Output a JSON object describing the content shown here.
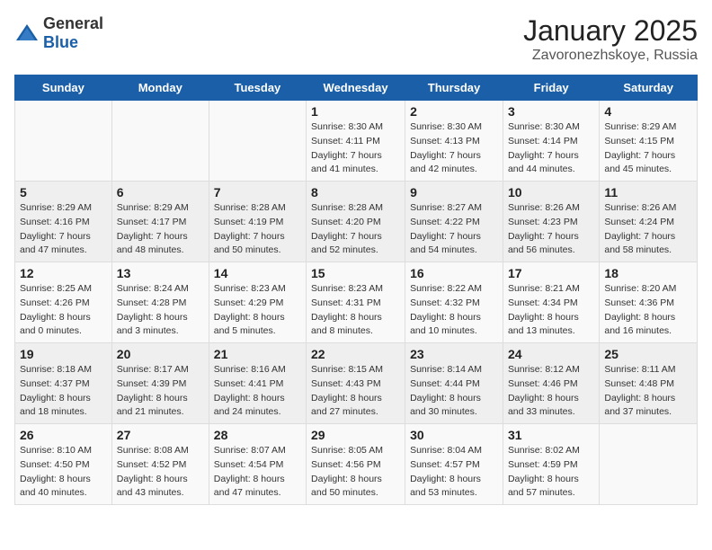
{
  "header": {
    "logo_general": "General",
    "logo_blue": "Blue",
    "month_title": "January 2025",
    "location": "Zavoronezhskoye, Russia"
  },
  "weekdays": [
    "Sunday",
    "Monday",
    "Tuesday",
    "Wednesday",
    "Thursday",
    "Friday",
    "Saturday"
  ],
  "weeks": [
    [
      {
        "day": "",
        "info": ""
      },
      {
        "day": "",
        "info": ""
      },
      {
        "day": "",
        "info": ""
      },
      {
        "day": "1",
        "info": "Sunrise: 8:30 AM\nSunset: 4:11 PM\nDaylight: 7 hours\nand 41 minutes."
      },
      {
        "day": "2",
        "info": "Sunrise: 8:30 AM\nSunset: 4:13 PM\nDaylight: 7 hours\nand 42 minutes."
      },
      {
        "day": "3",
        "info": "Sunrise: 8:30 AM\nSunset: 4:14 PM\nDaylight: 7 hours\nand 44 minutes."
      },
      {
        "day": "4",
        "info": "Sunrise: 8:29 AM\nSunset: 4:15 PM\nDaylight: 7 hours\nand 45 minutes."
      }
    ],
    [
      {
        "day": "5",
        "info": "Sunrise: 8:29 AM\nSunset: 4:16 PM\nDaylight: 7 hours\nand 47 minutes."
      },
      {
        "day": "6",
        "info": "Sunrise: 8:29 AM\nSunset: 4:17 PM\nDaylight: 7 hours\nand 48 minutes."
      },
      {
        "day": "7",
        "info": "Sunrise: 8:28 AM\nSunset: 4:19 PM\nDaylight: 7 hours\nand 50 minutes."
      },
      {
        "day": "8",
        "info": "Sunrise: 8:28 AM\nSunset: 4:20 PM\nDaylight: 7 hours\nand 52 minutes."
      },
      {
        "day": "9",
        "info": "Sunrise: 8:27 AM\nSunset: 4:22 PM\nDaylight: 7 hours\nand 54 minutes."
      },
      {
        "day": "10",
        "info": "Sunrise: 8:26 AM\nSunset: 4:23 PM\nDaylight: 7 hours\nand 56 minutes."
      },
      {
        "day": "11",
        "info": "Sunrise: 8:26 AM\nSunset: 4:24 PM\nDaylight: 7 hours\nand 58 minutes."
      }
    ],
    [
      {
        "day": "12",
        "info": "Sunrise: 8:25 AM\nSunset: 4:26 PM\nDaylight: 8 hours\nand 0 minutes."
      },
      {
        "day": "13",
        "info": "Sunrise: 8:24 AM\nSunset: 4:28 PM\nDaylight: 8 hours\nand 3 minutes."
      },
      {
        "day": "14",
        "info": "Sunrise: 8:23 AM\nSunset: 4:29 PM\nDaylight: 8 hours\nand 5 minutes."
      },
      {
        "day": "15",
        "info": "Sunrise: 8:23 AM\nSunset: 4:31 PM\nDaylight: 8 hours\nand 8 minutes."
      },
      {
        "day": "16",
        "info": "Sunrise: 8:22 AM\nSunset: 4:32 PM\nDaylight: 8 hours\nand 10 minutes."
      },
      {
        "day": "17",
        "info": "Sunrise: 8:21 AM\nSunset: 4:34 PM\nDaylight: 8 hours\nand 13 minutes."
      },
      {
        "day": "18",
        "info": "Sunrise: 8:20 AM\nSunset: 4:36 PM\nDaylight: 8 hours\nand 16 minutes."
      }
    ],
    [
      {
        "day": "19",
        "info": "Sunrise: 8:18 AM\nSunset: 4:37 PM\nDaylight: 8 hours\nand 18 minutes."
      },
      {
        "day": "20",
        "info": "Sunrise: 8:17 AM\nSunset: 4:39 PM\nDaylight: 8 hours\nand 21 minutes."
      },
      {
        "day": "21",
        "info": "Sunrise: 8:16 AM\nSunset: 4:41 PM\nDaylight: 8 hours\nand 24 minutes."
      },
      {
        "day": "22",
        "info": "Sunrise: 8:15 AM\nSunset: 4:43 PM\nDaylight: 8 hours\nand 27 minutes."
      },
      {
        "day": "23",
        "info": "Sunrise: 8:14 AM\nSunset: 4:44 PM\nDaylight: 8 hours\nand 30 minutes."
      },
      {
        "day": "24",
        "info": "Sunrise: 8:12 AM\nSunset: 4:46 PM\nDaylight: 8 hours\nand 33 minutes."
      },
      {
        "day": "25",
        "info": "Sunrise: 8:11 AM\nSunset: 4:48 PM\nDaylight: 8 hours\nand 37 minutes."
      }
    ],
    [
      {
        "day": "26",
        "info": "Sunrise: 8:10 AM\nSunset: 4:50 PM\nDaylight: 8 hours\nand 40 minutes."
      },
      {
        "day": "27",
        "info": "Sunrise: 8:08 AM\nSunset: 4:52 PM\nDaylight: 8 hours\nand 43 minutes."
      },
      {
        "day": "28",
        "info": "Sunrise: 8:07 AM\nSunset: 4:54 PM\nDaylight: 8 hours\nand 47 minutes."
      },
      {
        "day": "29",
        "info": "Sunrise: 8:05 AM\nSunset: 4:56 PM\nDaylight: 8 hours\nand 50 minutes."
      },
      {
        "day": "30",
        "info": "Sunrise: 8:04 AM\nSunset: 4:57 PM\nDaylight: 8 hours\nand 53 minutes."
      },
      {
        "day": "31",
        "info": "Sunrise: 8:02 AM\nSunset: 4:59 PM\nDaylight: 8 hours\nand 57 minutes."
      },
      {
        "day": "",
        "info": ""
      }
    ]
  ]
}
